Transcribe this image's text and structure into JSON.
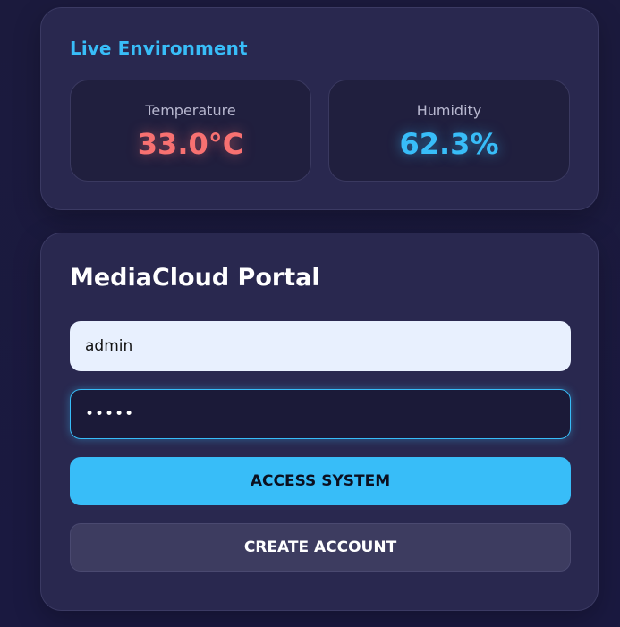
{
  "environment": {
    "title": "Live Environment",
    "temperature": {
      "label": "Temperature",
      "value": "33.0°C",
      "color": "#f87171"
    },
    "humidity": {
      "label": "Humidity",
      "value": "62.3%",
      "color": "#38bdf8"
    }
  },
  "login": {
    "title": "MediaCloud Portal",
    "username_value": "admin",
    "password_value": "•••••",
    "access_label": "ACCESS SYSTEM",
    "create_label": "CREATE ACCOUNT",
    "accent_color": "#38bdf8"
  }
}
